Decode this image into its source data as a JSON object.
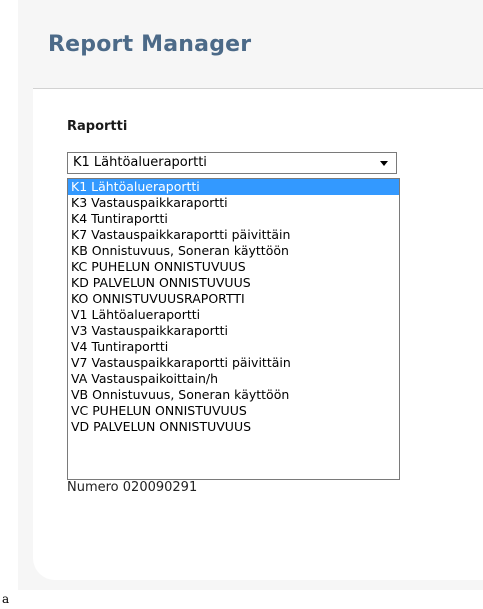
{
  "app": {
    "title": "Report Manager"
  },
  "report_section": {
    "label": "Raportti",
    "selected_value": "K1 Lähtöalueraportti",
    "options": [
      "K1 Lähtöalueraportti",
      "K3 Vastauspaikkaraportti",
      "K4 Tuntiraportti",
      "K7 Vastauspaikkaraportti päivittäin",
      "KB Onnistuvuus, Soneran käyttöön",
      "KC PUHELUN ONNISTUVUUS",
      "KD PALVELUN ONNISTUVUUS",
      "KO ONNISTUVUUSRAPORTTI",
      "V1 Lähtöalueraportti",
      "V3 Vastauspaikkaraportti",
      "V4 Tuntiraportti",
      "V7 Vastauspaikkaraportti päivittäin",
      "VA Vastauspaikoittain/h",
      "VB Onnistuvuus, Soneran käyttöön",
      "VC PUHELUN  ONNISTUVUUS",
      "VD PALVELUN ONNISTUVUUS"
    ]
  },
  "partially_hidden_text": "Numero 020090291",
  "corner_glyph": "a",
  "colors": {
    "title": "#4c6a88",
    "selection": "#3399ff",
    "panel_bg": "#f6f6f6"
  }
}
